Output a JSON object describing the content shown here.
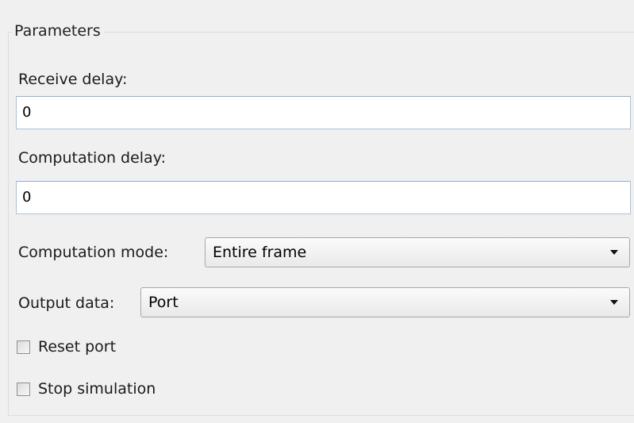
{
  "group": {
    "legend": "Parameters"
  },
  "receive_delay": {
    "label": "Receive delay:",
    "value": "0"
  },
  "computation_delay": {
    "label": "Computation delay:",
    "value": "0"
  },
  "computation_mode": {
    "label": "Computation mode:",
    "selected": "Entire frame"
  },
  "output_data": {
    "label": "Output data:",
    "selected": "Port"
  },
  "reset_port": {
    "label": "Reset port",
    "checked": false
  },
  "stop_simulation": {
    "label": "Stop simulation",
    "checked": false
  },
  "colors": {
    "panel_bg": "#f0f0f0",
    "field_border": "#a9c2de"
  }
}
